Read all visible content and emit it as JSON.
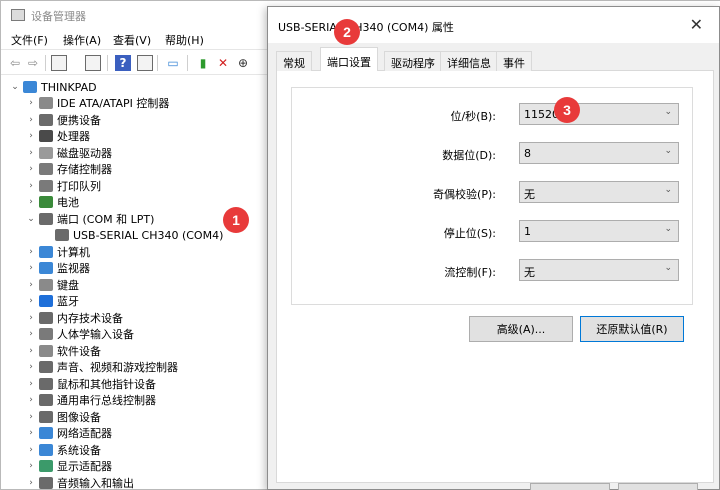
{
  "device_manager": {
    "title": "设备管理器",
    "menu": [
      "文件(F)",
      "操作(A)",
      "查看(V)",
      "帮助(H)"
    ],
    "root": "THINKPAD",
    "items": [
      {
        "label": "IDE ATA/ATAPI 控制器",
        "icon": "ide-icon",
        "color": "#8a8a8a",
        "expanded": false
      },
      {
        "label": "便携设备",
        "icon": "portable-device-icon",
        "color": "#6b6b6b",
        "expanded": false
      },
      {
        "label": "处理器",
        "icon": "processor-icon",
        "color": "#4a4a4a",
        "expanded": false
      },
      {
        "label": "磁盘驱动器",
        "icon": "disk-drive-icon",
        "color": "#9a9a9a",
        "expanded": false
      },
      {
        "label": "存储控制器",
        "icon": "storage-controller-icon",
        "color": "#7a7a7a",
        "expanded": false
      },
      {
        "label": "打印队列",
        "icon": "printer-icon",
        "color": "#7a7a7a",
        "expanded": false
      },
      {
        "label": "电池",
        "icon": "battery-icon",
        "color": "#3a8a3a",
        "expanded": false
      },
      {
        "label": "端口 (COM 和 LPT)",
        "icon": "port-icon",
        "color": "#6a6a6a",
        "expanded": true
      },
      {
        "label": "计算机",
        "icon": "computer-icon",
        "color": "#3b87d6",
        "expanded": false
      },
      {
        "label": "监视器",
        "icon": "monitor-icon",
        "color": "#3b87d6",
        "expanded": false
      },
      {
        "label": "键盘",
        "icon": "keyboard-icon",
        "color": "#8a8a8a",
        "expanded": false
      },
      {
        "label": "蓝牙",
        "icon": "bluetooth-icon",
        "color": "#1e6fd9",
        "expanded": false
      },
      {
        "label": "内存技术设备",
        "icon": "memory-device-icon",
        "color": "#6a6a6a",
        "expanded": false
      },
      {
        "label": "人体学输入设备",
        "icon": "hid-icon",
        "color": "#7a7a7a",
        "expanded": false
      },
      {
        "label": "软件设备",
        "icon": "software-device-icon",
        "color": "#8a8a8a",
        "expanded": false
      },
      {
        "label": "声音、视频和游戏控制器",
        "icon": "sound-icon",
        "color": "#6a6a6a",
        "expanded": false
      },
      {
        "label": "鼠标和其他指针设备",
        "icon": "mouse-icon",
        "color": "#6a6a6a",
        "expanded": false
      },
      {
        "label": "通用串行总线控制器",
        "icon": "usb-icon",
        "color": "#6a6a6a",
        "expanded": false
      },
      {
        "label": "图像设备",
        "icon": "camera-icon",
        "color": "#6a6a6a",
        "expanded": false
      },
      {
        "label": "网络适配器",
        "icon": "network-adapter-icon",
        "color": "#3b87d6",
        "expanded": false
      },
      {
        "label": "系统设备",
        "icon": "system-device-icon",
        "color": "#3b87d6",
        "expanded": false
      },
      {
        "label": "显示适配器",
        "icon": "display-adapter-icon",
        "color": "#3b9a6a",
        "expanded": false
      },
      {
        "label": "音频输入和输出",
        "icon": "audio-icon",
        "color": "#6a6a6a",
        "expanded": false
      }
    ],
    "port_child": "USB-SERIAL CH340 (COM4)"
  },
  "dialog": {
    "title": "USB-SERIAL CH340 (COM4) 属性",
    "tabs": [
      "常规",
      "端口设置",
      "驱动程序",
      "详细信息",
      "事件"
    ],
    "active_tab": "端口设置",
    "fields": [
      {
        "label": "位/秒(B):",
        "value": "115200"
      },
      {
        "label": "数据位(D):",
        "value": "8"
      },
      {
        "label": "奇偶校验(P):",
        "value": "无"
      },
      {
        "label": "停止位(S):",
        "value": "1"
      },
      {
        "label": "流控制(F):",
        "value": "无"
      }
    ],
    "buttons": {
      "advanced": "高级(A)...",
      "restore": "还原默认值(R)"
    }
  },
  "markers": [
    "1",
    "2",
    "3"
  ],
  "colors": {
    "marker": "#e83a3a",
    "accent": "#0078d7"
  }
}
